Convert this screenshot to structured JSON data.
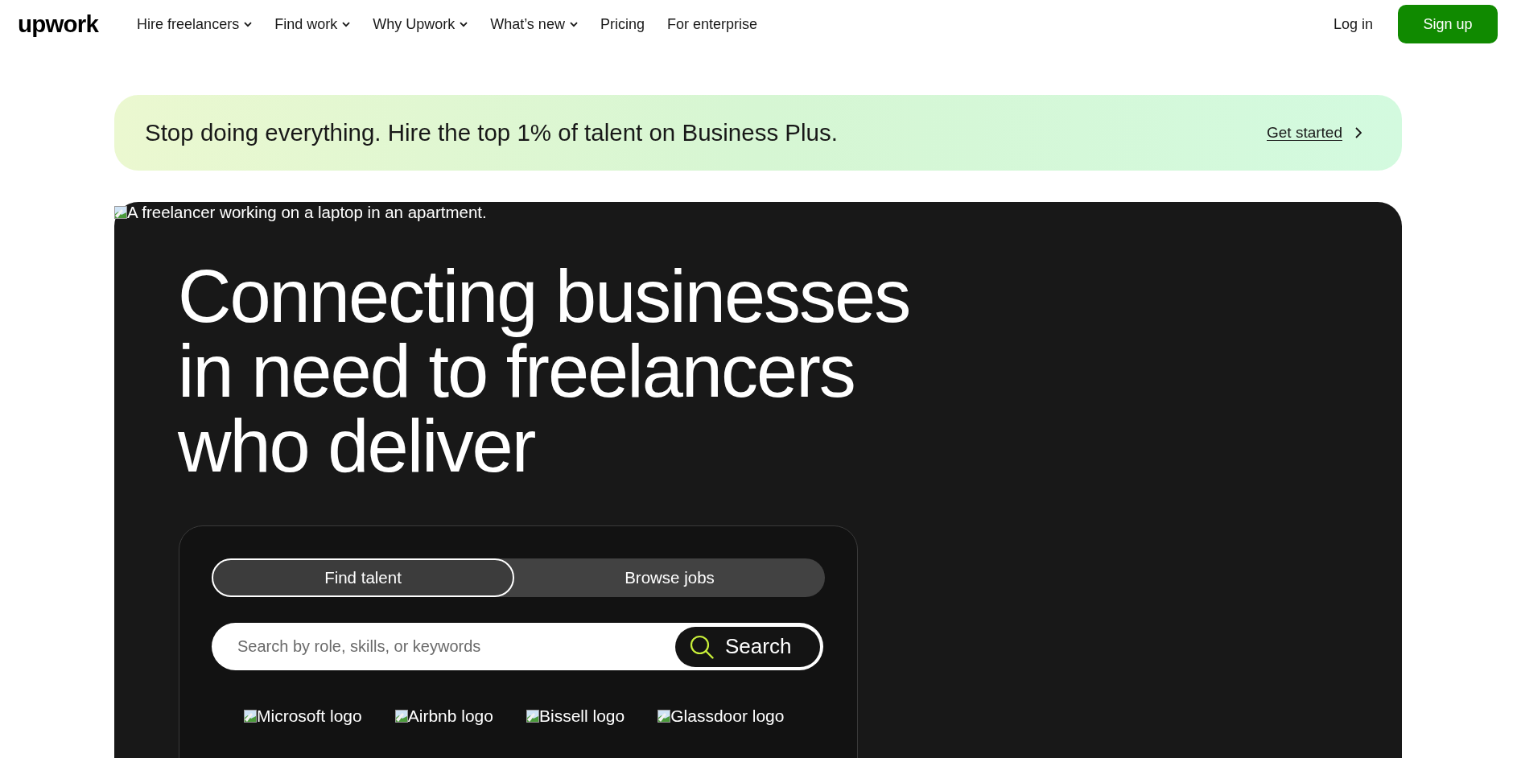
{
  "header": {
    "logo": "upwork",
    "nav": [
      {
        "label": "Hire freelancers",
        "has_menu": true
      },
      {
        "label": "Find work",
        "has_menu": true
      },
      {
        "label": "Why Upwork",
        "has_menu": true
      },
      {
        "label": "What’s new",
        "has_menu": true
      },
      {
        "label": "Pricing",
        "has_menu": false
      },
      {
        "label": "For enterprise",
        "has_menu": false
      }
    ],
    "login": "Log in",
    "signup": "Sign up"
  },
  "banner": {
    "text": "Stop doing everything. Hire the top 1% of talent on Business Plus.",
    "link": "Get started"
  },
  "hero": {
    "image_alt": "A freelancer working on a laptop in an apartment.",
    "heading": "Connecting businesses in need to freelancers who deliver",
    "tabs": [
      {
        "label": "Find talent",
        "selected": true
      },
      {
        "label": "Browse jobs",
        "selected": false
      }
    ],
    "search": {
      "placeholder": "Search by role, skills, or keywords",
      "button": "Search"
    },
    "logos": [
      "Microsoft logo",
      "Airbnb logo",
      "Bissell logo",
      "Glassdoor logo"
    ]
  }
}
